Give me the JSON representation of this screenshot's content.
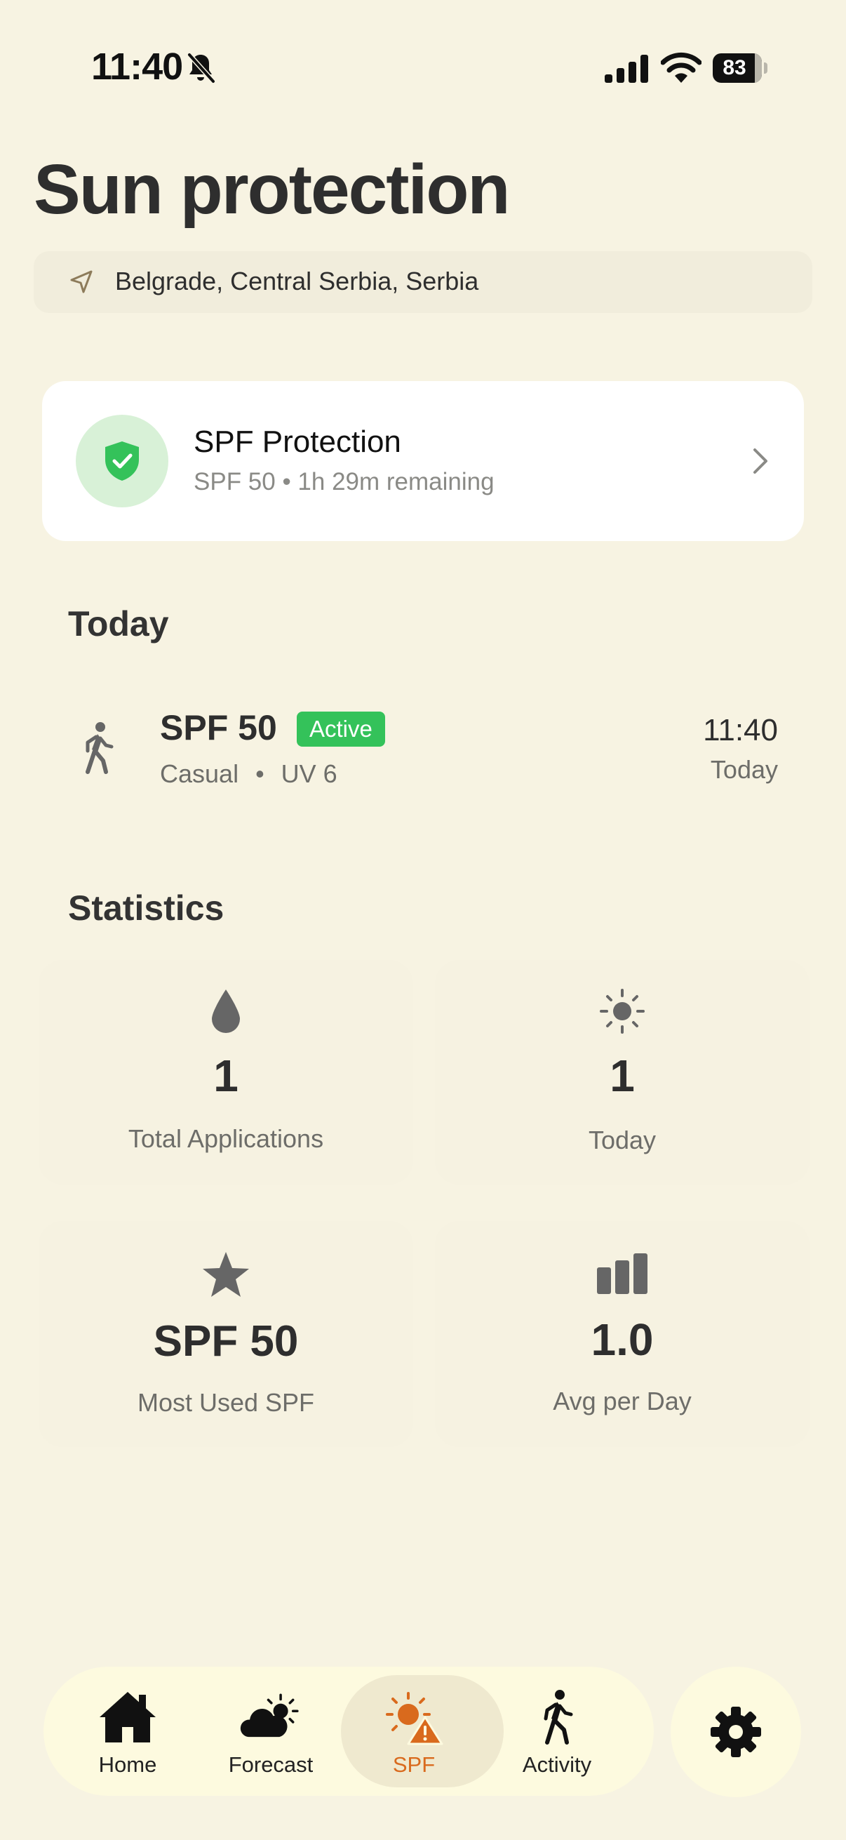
{
  "status_bar": {
    "time": "11:40",
    "battery": "83"
  },
  "header": {
    "title": "Sun protection",
    "location": "Belgrade, Central Serbia, Serbia"
  },
  "protection_card": {
    "title": "SPF Protection",
    "subtitle": "SPF 50 • 1h 29m remaining"
  },
  "today": {
    "section_title": "Today",
    "entry": {
      "spf": "SPF 50",
      "badge": "Active",
      "activity": "Casual",
      "separator": "•",
      "uv": "UV 6",
      "time": "11:40",
      "day": "Today"
    }
  },
  "statistics": {
    "section_title": "Statistics",
    "cards": [
      {
        "icon": "drop-icon",
        "value": "1",
        "label": "Total Applications"
      },
      {
        "icon": "sun-icon",
        "value": "1",
        "label": "Today"
      },
      {
        "icon": "star-icon",
        "value": "SPF 50",
        "label": "Most Used SPF"
      },
      {
        "icon": "bar-chart-icon",
        "value": "1.0",
        "label": "Avg per Day"
      }
    ]
  },
  "tabs": [
    {
      "label": "Home",
      "icon": "house-icon",
      "selected": false
    },
    {
      "label": "Forecast",
      "icon": "cloud-sun-icon",
      "selected": false
    },
    {
      "label": "SPF",
      "icon": "sun-warning-icon",
      "selected": true
    },
    {
      "label": "Activity",
      "icon": "walking-person-icon",
      "selected": false
    }
  ],
  "colors": {
    "background": "#f7f3e2",
    "accent": "#d96a1d",
    "active_badge": "#34c25a",
    "shield": "#34c25a",
    "icon_gray": "#666666"
  }
}
